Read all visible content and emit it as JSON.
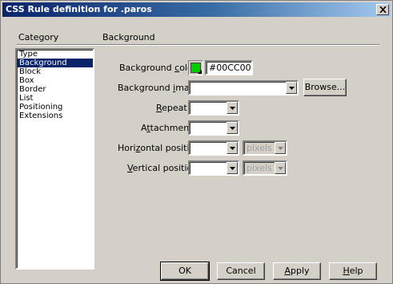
{
  "window": {
    "title": "CSS Rule definition for .paros"
  },
  "category": {
    "header": "Category",
    "items": [
      "Type",
      "Background",
      "Block",
      "Box",
      "Border",
      "List",
      "Positioning",
      "Extensions"
    ],
    "selected": "Background"
  },
  "panel": {
    "title": "Background"
  },
  "fields": {
    "bg_color_label_pre": "Background ",
    "bg_color_label_acc": "c",
    "bg_color_label_post": "olor:",
    "bg_color_value": "#00CC00",
    "bg_color_swatch": "#00cc00",
    "bg_image_label_pre": "Background ",
    "bg_image_label_acc": "i",
    "bg_image_label_post": "mage:",
    "bg_image_value": "",
    "browse_label": "Browse...",
    "repeat_label_acc": "R",
    "repeat_label_post": "epeat:",
    "repeat_value": "",
    "attachment_label_pre": "A",
    "attachment_label_acc": "t",
    "attachment_label_post": "tachment:",
    "attachment_value": "",
    "hpos_label_pre": "Hori",
    "hpos_label_acc": "z",
    "hpos_label_post": "ontal position:",
    "hpos_value": "",
    "hpos_unit": "pixels",
    "vpos_label_acc": "V",
    "vpos_label_post": "ertical position:",
    "vpos_value": "",
    "vpos_unit": "pixels"
  },
  "buttons": {
    "ok": "OK",
    "cancel": "Cancel",
    "apply_acc": "A",
    "apply_post": "pply",
    "help_acc": "H",
    "help_post": "elp"
  },
  "colors": {
    "title_bar": "#0a246a",
    "selection": "#0a246a",
    "face": "#d4d0c8"
  }
}
